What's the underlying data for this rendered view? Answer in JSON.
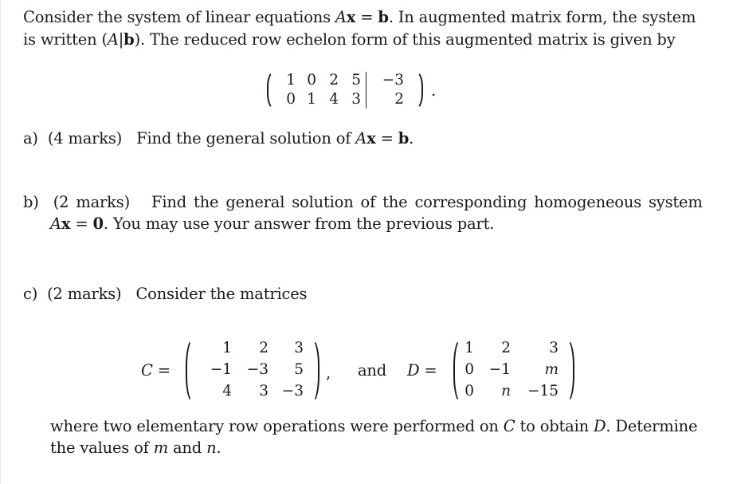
{
  "intro": {
    "line1": {
      "t1": "Consider the system of linear equations ",
      "A": "A",
      "x": "x",
      "eq": " = ",
      "b": "b",
      "t2": ". In augmented matrix form, the system"
    },
    "line2": {
      "t1": "is written (",
      "A": "A",
      "bar": "|",
      "b": "b",
      "t2": "). The reduced row echelon form of this augmented matrix is given by"
    }
  },
  "rref_matrix": {
    "coefficients": [
      [
        "1",
        "0",
        "2",
        "5"
      ],
      [
        "0",
        "1",
        "4",
        "3"
      ]
    ],
    "rhs": [
      "−3",
      "2"
    ],
    "trailing": "."
  },
  "part_a": {
    "label": "a)",
    "marks": "(4 marks)",
    "text": "Find the general solution of ",
    "A": "A",
    "x": "x",
    "eq": " = ",
    "b": "b",
    "end": "."
  },
  "part_b": {
    "label": "b)",
    "marks": "(2 marks)",
    "text1": "Find the general solution of the corresponding homogeneous system",
    "A": "A",
    "x": "x",
    "eq": " = ",
    "zero": "0",
    "text2": ". You may use your answer from the previous part."
  },
  "part_c": {
    "label": "c)",
    "marks": "(2 marks)",
    "text": "Consider the matrices",
    "C_label": "C",
    "D_label": "D",
    "eq": " =",
    "comma": ",",
    "and": "and",
    "matrix_C": [
      [
        "1",
        "2",
        "3"
      ],
      [
        "−1",
        "−3",
        "5"
      ],
      [
        "4",
        "3",
        "−3"
      ]
    ],
    "matrix_D": [
      [
        "1",
        "2",
        "3"
      ],
      [
        "0",
        "−1",
        "m"
      ],
      [
        "0",
        "n",
        "−15"
      ]
    ],
    "closing1": {
      "t1": "where two elementary row operations were performed on ",
      "C": "C",
      "t2": " to obtain ",
      "D": "D",
      "t3": ". Determine"
    },
    "closing2": {
      "t1": "the values of ",
      "m": "m",
      "t2": " and ",
      "n": "n",
      "t3": "."
    }
  }
}
